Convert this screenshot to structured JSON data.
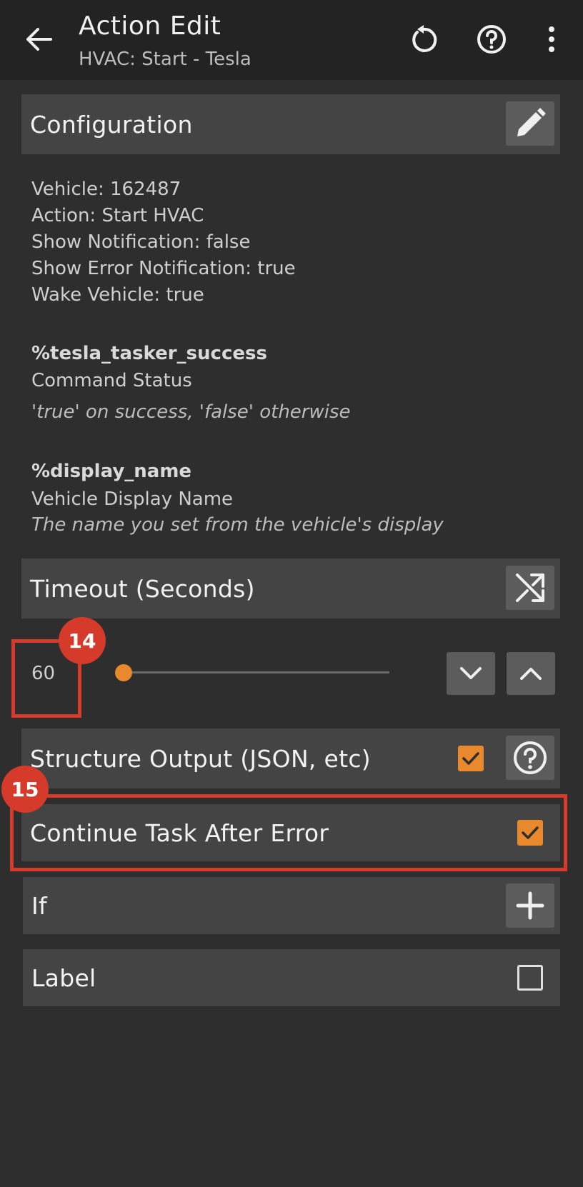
{
  "appbar": {
    "title": "Action Edit",
    "subtitle": "HVAC: Start - Tesla",
    "icons": [
      "back-arrow-icon",
      "reset-icon",
      "help-icon",
      "more-vert-icon"
    ]
  },
  "configuration": {
    "header": "Configuration",
    "lines": [
      "Vehicle: 162487",
      "Action: Start HVAC",
      "Show Notification: false",
      "Show Error Notification: true",
      "Wake Vehicle: true"
    ],
    "variables": [
      {
        "name": "%tesla_tasker_success",
        "label": "Command Status",
        "description": "'true' on success, 'false' otherwise"
      },
      {
        "name": "%display_name",
        "label": "Vehicle Display Name",
        "description": "The name you set from the vehicle's display"
      }
    ]
  },
  "timeout": {
    "header": "Timeout (Seconds)",
    "value": "60",
    "slider_fraction": 0.0
  },
  "structure_output": {
    "label": "Structure Output (JSON, etc)",
    "checked": true
  },
  "continue_after_error": {
    "label": "Continue Task After Error",
    "checked": true
  },
  "if_row": {
    "label": "If"
  },
  "label_row": {
    "label": "Label",
    "checked": false
  },
  "annotations": {
    "badge_14": "14",
    "badge_15": "15"
  },
  "colors": {
    "accent": "#e8892e",
    "annotation": "#d63a2a",
    "background": "#2e2e2e",
    "appbar": "#232323"
  }
}
